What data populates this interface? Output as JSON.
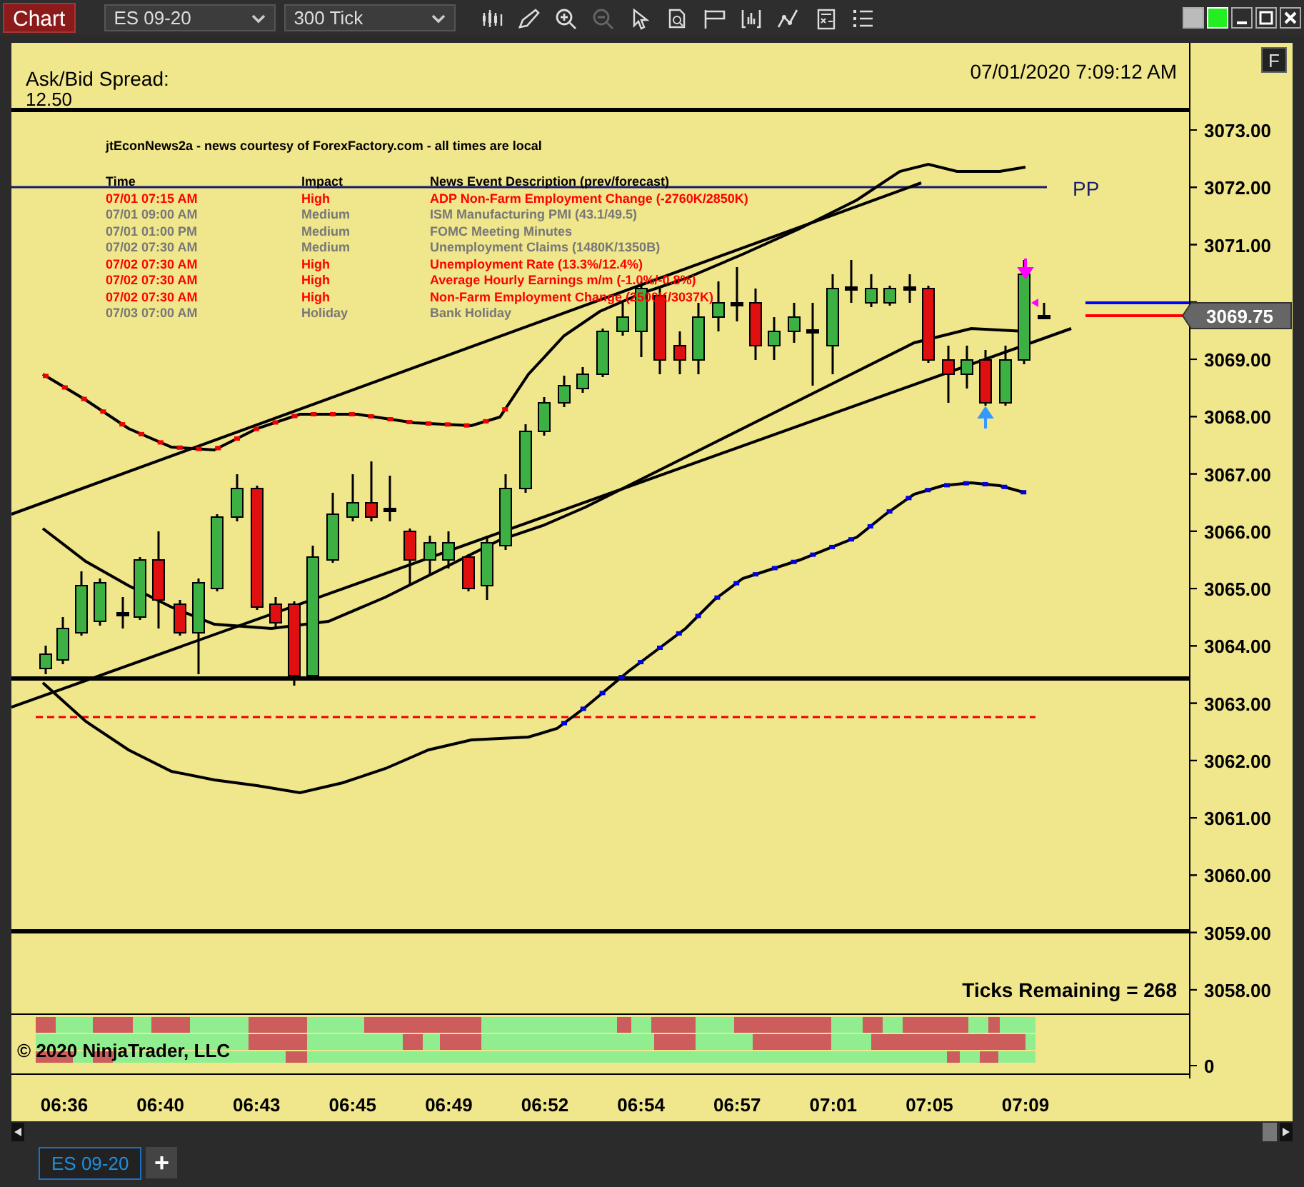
{
  "toolbar": {
    "title": "Chart",
    "instrument": "ES 09-20",
    "interval": "300 Tick"
  },
  "chart": {
    "timestamp": "07/01/2020 7:09:12 AM",
    "spread_label": "Ask/Bid Spread:",
    "spread_value": "12.50",
    "f_button": "F",
    "news": {
      "title": "jtEconNews2a - news courtesy of ForexFactory.com - all times are local",
      "columns": [
        "Time",
        "Impact",
        "News Event Description (prev/forecast)"
      ],
      "rows": [
        {
          "time": "07/01 07:15 AM",
          "impact": "High",
          "description": "ADP Non-Farm Employment Change (-2760K/2850K)",
          "kind": "high"
        },
        {
          "time": "07/01 09:00 AM",
          "impact": "Medium",
          "description": "ISM Manufacturing PMI (43.1/49.5)",
          "kind": "medium"
        },
        {
          "time": "07/01 01:00 PM",
          "impact": "Medium",
          "description": "FOMC Meeting Minutes",
          "kind": "medium"
        },
        {
          "time": "07/02 07:30 AM",
          "impact": "Medium",
          "description": "Unemployment Claims (1480K/1350B)",
          "kind": "medium"
        },
        {
          "time": "07/02 07:30 AM",
          "impact": "High",
          "description": "Unemployment Rate (13.3%/12.4%)",
          "kind": "high"
        },
        {
          "time": "07/02 07:30 AM",
          "impact": "High",
          "description": "Average Hourly Earnings m/m (-1.0%/-0.8%)",
          "kind": "high"
        },
        {
          "time": "07/02 07:30 AM",
          "impact": "High",
          "description": "Non-Farm Employment Change (2500K/3037K)",
          "kind": "high"
        },
        {
          "time": "07/03 07:00 AM",
          "impact": "Holiday",
          "description": "Bank Holiday",
          "kind": "holiday"
        }
      ]
    },
    "pp_label": "PP",
    "ticks_remaining": "Ticks Remaining = 268",
    "copyright": "© 2020 NinjaTrader, LLC",
    "price_axis_upper": [
      "3073.00",
      "3072.00",
      "3071.00"
    ],
    "price_axis_lower": [
      "3069.00",
      "3068.00",
      "3067.00",
      "3066.00",
      "3065.00",
      "3064.00",
      "3063.00",
      "3062.00",
      "3061.00",
      "3060.00",
      "3059.00",
      "3058.00"
    ],
    "last_price": "3069.75",
    "indicator_axis": [
      "0"
    ],
    "time_axis": [
      "06:36",
      "06:40",
      "06:43",
      "06:45",
      "06:49",
      "06:52",
      "06:54",
      "06:57",
      "07:01",
      "07:05",
      "07:09"
    ]
  },
  "tabs": [
    {
      "label": "ES 09-20",
      "selected": true
    }
  ],
  "add_tab": "+"
}
